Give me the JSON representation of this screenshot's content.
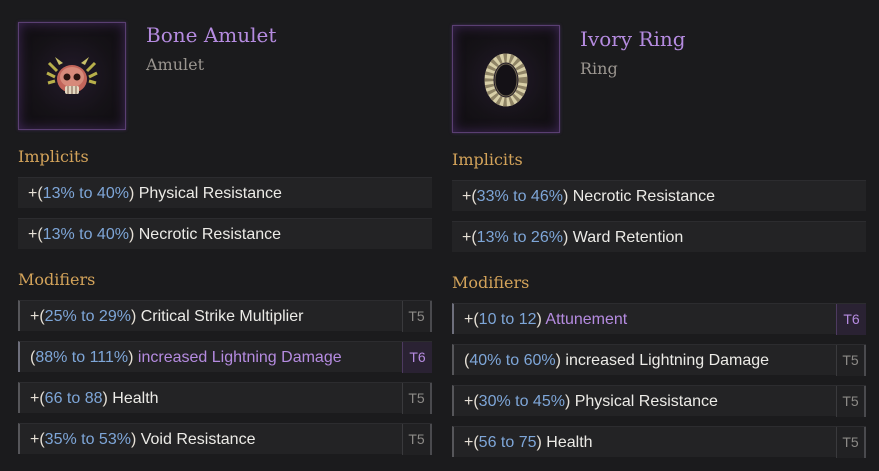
{
  "items": [
    {
      "name": "Bone Amulet",
      "type": "Amulet",
      "icon": "skull-amulet-icon",
      "implicits_title": "Implicits",
      "implicits": [
        {
          "prefix": "+(",
          "range": "13% to 40%",
          "suffix": ")",
          "stat": "Physical Resistance"
        },
        {
          "prefix": "+(",
          "range": "13% to 40%",
          "suffix": ")",
          "stat": "Necrotic Resistance"
        }
      ],
      "modifiers_title": "Modifiers",
      "modifiers": [
        {
          "prefix": "+(",
          "range": "25% to 29%",
          "suffix": ")",
          "stat": "Critical Strike Multiplier",
          "tier": "T5"
        },
        {
          "prefix": "(",
          "range": "88% to 111%",
          "suffix": ")",
          "stat": "increased Lightning Damage",
          "tier": "T6"
        },
        {
          "prefix": "+(",
          "range": "66 to 88",
          "suffix": ")",
          "stat": "Health",
          "tier": "T5"
        },
        {
          "prefix": "+(",
          "range": "35% to 53%",
          "suffix": ")",
          "stat": "Void Resistance",
          "tier": "T5"
        }
      ]
    },
    {
      "name": "Ivory Ring",
      "type": "Ring",
      "icon": "ring-icon",
      "implicits_title": "Implicits",
      "implicits": [
        {
          "prefix": "+(",
          "range": "33% to 46%",
          "suffix": ")",
          "stat": "Necrotic Resistance"
        },
        {
          "prefix": "+(",
          "range": "13% to 26%",
          "suffix": ")",
          "stat": "Ward Retention"
        }
      ],
      "modifiers_title": "Modifiers",
      "modifiers": [
        {
          "prefix": "+(",
          "range": "10 to 12",
          "suffix": ")",
          "stat": "Attunement",
          "tier": "T6"
        },
        {
          "prefix": "(",
          "range": "40% to 60%",
          "suffix": ")",
          "stat": "increased Lightning Damage",
          "tier": "T5"
        },
        {
          "prefix": "+(",
          "range": "30% to 45%",
          "suffix": ")",
          "stat": "Physical Resistance",
          "tier": "T5"
        },
        {
          "prefix": "+(",
          "range": "56 to 75",
          "suffix": ")",
          "stat": "Health",
          "tier": "T5"
        }
      ]
    }
  ],
  "colors": {
    "item_name": "#b58be0",
    "section_title": "#d3a35a",
    "range": "#7ea6d8",
    "exalted_tier": "#b58be0"
  }
}
